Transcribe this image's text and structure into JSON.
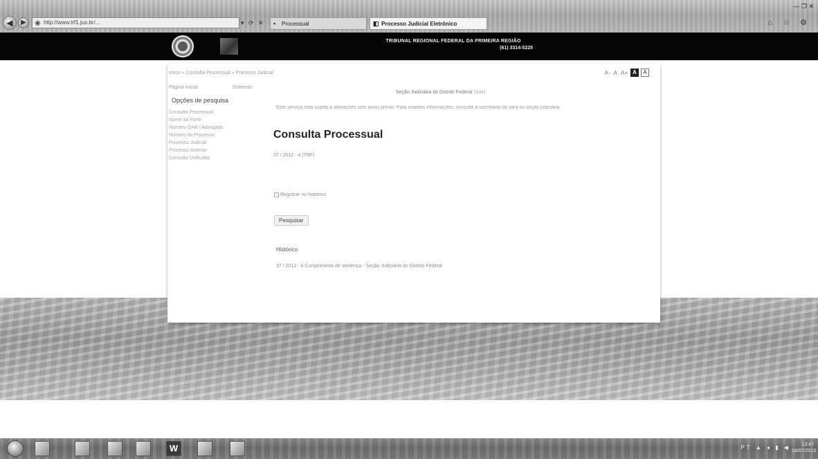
{
  "browser": {
    "address": "http://www.trf1.jus.br/...",
    "address_controls": "▾ ⟳ ✕",
    "tabs": [
      {
        "label": "Processual"
      },
      {
        "label": "Processo Judicial Eletrônico"
      }
    ],
    "window_controls": "— ❐ ✕",
    "fav_icons": "⌂ ☆ ⚙"
  },
  "site": {
    "court_name": "TRIBUNAL REGIONAL FEDERAL DA PRIMEIRA REGIÃO",
    "court_phone": "(61) 3314-5225"
  },
  "breadcrumb": "Início » Consulta Processual » Processo Judicial",
  "font_controls": {
    "decrease": "A-",
    "normal": "A",
    "increase": "A+",
    "dark": "A",
    "light": "A"
  },
  "sidebar": {
    "top_links": [
      "Página Inicial",
      "Sistemas"
    ],
    "heading": "Opções de pesquisa",
    "items": [
      "Consulta Processual",
      "Nome da Parte",
      "Número OAB / Advogado",
      "Número do Processo",
      "Processo Judicial",
      "Processo Anterior",
      "Consulta Unificada"
    ]
  },
  "main": {
    "session_text": "Seção Judiciária do Distrito Federal",
    "logout_label": "(Sair)",
    "notice": "Este serviço está sujeito a alterações sem aviso prévio. Para maiores informações, consulte a secretaria da vara ou seção judiciária.",
    "title": "Consulta Processual",
    "process_number": "37 / 2012 - 4 (TRF)",
    "register_label": "Registrar no histórico",
    "search_button": "Pesquisar",
    "history_heading": "Histórico",
    "history_item": "37 / 2012 - 4 Cumprimento de sentença - Seção Judiciária do Distrito Federal"
  },
  "taskbar": {
    "word_label": "W",
    "tray": "PT ▲ ◂ ▮ ◀",
    "clock_time": "13:47",
    "clock_date": "18/07/2013"
  }
}
